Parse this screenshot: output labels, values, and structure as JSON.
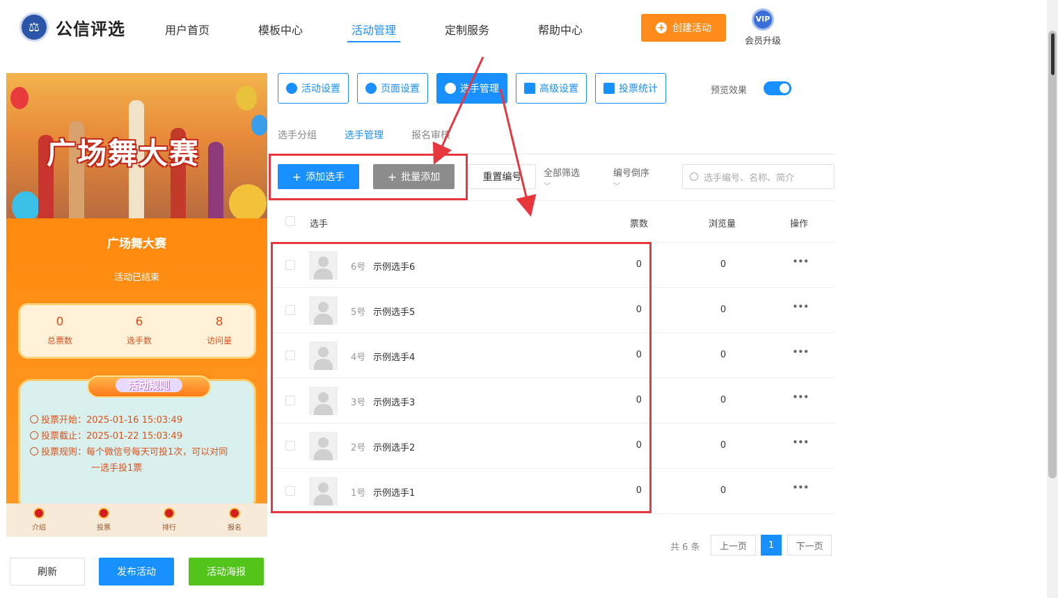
{
  "brand": {
    "name": "公信评选"
  },
  "nav": {
    "items": [
      "用户首页",
      "模板中心",
      "活动管理",
      "定制服务",
      "帮助中心"
    ],
    "active_index": 2
  },
  "header_actions": {
    "create_label": "创建活动",
    "vip_label": "会员升级",
    "vip_badge": "VIP"
  },
  "preview": {
    "banner_title": "广场舞大赛",
    "title": "广场舞大赛",
    "status": "活动已结束",
    "stats": [
      {
        "value": "0",
        "label": "总票数"
      },
      {
        "value": "6",
        "label": "选手数"
      },
      {
        "value": "8",
        "label": "访问量"
      }
    ],
    "rules": {
      "heading": "活动规则",
      "start_label": "投票开始：",
      "start_value": "2025-01-16 15:03:49",
      "end_label": "投票截止：",
      "end_value": "2025-01-22 15:03:49",
      "rule_label": "投票规则：",
      "rule_text_1": "每个微信号每天可投1次，可以对同",
      "rule_text_2": "一选手投1票"
    },
    "tabbar": [
      "介绍",
      "投票",
      "排行",
      "报名"
    ]
  },
  "preview_actions": {
    "refresh": "刷新",
    "publish": "发布活动",
    "poster": "活动海报"
  },
  "settings_tabs": [
    "活动设置",
    "页面设置",
    "选手管理",
    "高级设置",
    "投票统计"
  ],
  "settings_active_index": 2,
  "preview_toggle": {
    "label": "预览效果",
    "on": true
  },
  "subtabs": [
    "选手分组",
    "选手管理",
    "报名审核"
  ],
  "subtab_active_index": 1,
  "toolbar": {
    "add": "添加选手",
    "batch_add": "批量添加",
    "reset_no": "重置编号",
    "filter": "全部筛选",
    "sort": "编号倒序",
    "search_placeholder": "选手编号、名称、简介"
  },
  "table": {
    "headers": {
      "player": "选手",
      "votes": "票数",
      "views": "浏览量",
      "ops": "操作"
    },
    "rows": [
      {
        "no": "6号",
        "name": "示例选手6",
        "votes": "0",
        "views": "0",
        "op": "•••"
      },
      {
        "no": "5号",
        "name": "示例选手5",
        "votes": "0",
        "views": "0",
        "op": "•••"
      },
      {
        "no": "4号",
        "name": "示例选手4",
        "votes": "0",
        "views": "0",
        "op": "•••"
      },
      {
        "no": "3号",
        "name": "示例选手3",
        "votes": "0",
        "views": "0",
        "op": "•••"
      },
      {
        "no": "2号",
        "name": "示例选手2",
        "votes": "0",
        "views": "0",
        "op": "•••"
      },
      {
        "no": "1号",
        "name": "示例选手1",
        "votes": "0",
        "views": "0",
        "op": "•••"
      }
    ]
  },
  "pagination": {
    "total": "共 6 条",
    "prev": "上一页",
    "current": "1",
    "next": "下一页"
  },
  "colors": {
    "primary": "#1890ff",
    "orange": "#ff8c1a",
    "green": "#52c41a",
    "annotation_red": "#e8363f"
  }
}
